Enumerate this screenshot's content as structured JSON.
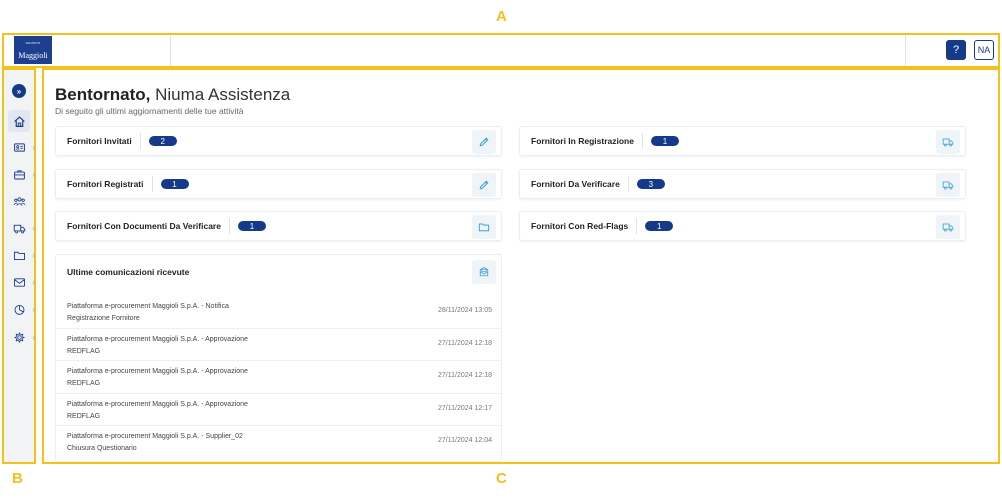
{
  "annotations": {
    "a": "A",
    "b": "B",
    "c": "C"
  },
  "header": {
    "logo_top": "GRUPPO",
    "logo_main": "Maggioli",
    "help_label": "?",
    "user_initials": "NA"
  },
  "sidebar": {
    "expand_icon": "»",
    "chevron": "›",
    "items": [
      {
        "icon": "home-icon",
        "has_submenu": false
      },
      {
        "icon": "id-card-icon",
        "has_submenu": true
      },
      {
        "icon": "briefcase-icon",
        "has_submenu": true
      },
      {
        "icon": "users-icon",
        "has_submenu": false
      },
      {
        "icon": "truck-icon",
        "has_submenu": true
      },
      {
        "icon": "folder-icon",
        "has_submenu": true
      },
      {
        "icon": "mail-icon",
        "has_submenu": true
      },
      {
        "icon": "chart-pie-icon",
        "has_submenu": true
      },
      {
        "icon": "gear-icon",
        "has_submenu": true
      }
    ]
  },
  "main": {
    "welcome_bold": "Bentornato,",
    "welcome_name": " Niuma Assistenza",
    "subtitle": "Di seguito gli ultimi aggiornamenti delle tue attività",
    "cards_left": [
      {
        "title": "Fornitori Invitati",
        "count": "2",
        "icon": "pencil-icon"
      },
      {
        "title": "Fornitori Registrati",
        "count": "1",
        "icon": "pencil-icon"
      },
      {
        "title": "Fornitori Con Documenti Da Verificare",
        "count": "1",
        "icon": "folder-icon"
      }
    ],
    "cards_right": [
      {
        "title": "Fornitori In Registrazione",
        "count": "1",
        "icon": "truck-icon"
      },
      {
        "title": "Fornitori Da Verificare",
        "count": "3",
        "icon": "truck-icon"
      },
      {
        "title": "Fornitori Con Red-Flags",
        "count": "1",
        "icon": "truck-icon"
      }
    ],
    "messages": {
      "title": "Ultime comunicazioni ricevute",
      "icon": "inbox-icon",
      "items": [
        {
          "line1": "Piattaforma e-procurement Maggioli S.p.A. - Notifica",
          "line2": "Registrazione Fornitore",
          "date": "28/11/2024 13:05"
        },
        {
          "line1": "Piattaforma e-procurement Maggioli S.p.A. - Approvazione",
          "line2": "REDFLAG",
          "date": "27/11/2024 12:18"
        },
        {
          "line1": "Piattaforma e-procurement Maggioli S.p.A. - Approvazione",
          "line2": "REDFLAG",
          "date": "27/11/2024 12:18"
        },
        {
          "line1": "Piattaforma e-procurement Maggioli S.p.A. - Approvazione",
          "line2": "REDFLAG",
          "date": "27/11/2024 12:17"
        },
        {
          "line1": "Piattaforma e-procurement Maggioli S.p.A. - Supplier_02",
          "line2": "Chiusura Questionario",
          "date": "27/11/2024 12:04"
        }
      ]
    }
  },
  "colors": {
    "primary": "#163a8a",
    "annotation": "#f3c11b",
    "icon_accent": "#3aa0d0"
  }
}
